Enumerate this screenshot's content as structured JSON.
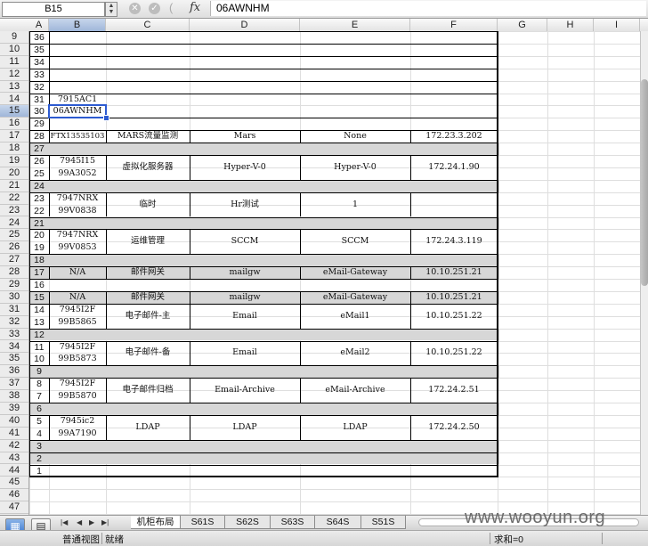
{
  "formula_bar": {
    "name_box": "B15",
    "cancel_glyph": "✕",
    "confirm_glyph": "✓",
    "paren_glyph": "(",
    "fx_label": "fx",
    "value": "06AWNHM"
  },
  "columns": [
    "A",
    "B",
    "C",
    "D",
    "E",
    "F",
    "G",
    "H",
    "I"
  ],
  "selected_column": "B",
  "rows": [
    "9",
    "10",
    "11",
    "12",
    "13",
    "14",
    "15",
    "16",
    "17",
    "18",
    "19",
    "20",
    "21",
    "22",
    "23",
    "24",
    "25",
    "26",
    "27",
    "28",
    "29",
    "30",
    "31",
    "32",
    "33",
    "34",
    "35",
    "36",
    "37",
    "38",
    "39",
    "40",
    "41",
    "42",
    "43",
    "44",
    "45",
    "46",
    "47"
  ],
  "selected_row": "15",
  "col_a_values": [
    "36",
    "35",
    "34",
    "33",
    "32",
    "31",
    "30",
    "29",
    "28",
    "27",
    "26",
    "25",
    "24",
    "23",
    "22",
    "21",
    "20",
    "19",
    "18",
    "17",
    "16",
    "15",
    "14",
    "13",
    "12",
    "11",
    "10",
    "9",
    "8",
    "7",
    "6",
    "5",
    "4",
    "3",
    "2",
    "1"
  ],
  "entries": [
    {
      "b": "7915AC1",
      "c": "",
      "d": "",
      "e": "",
      "f": ""
    },
    {
      "b": "06AWNHM",
      "c": "",
      "d": "",
      "e": "",
      "f": ""
    },
    {
      "b": "FTX13535103",
      "c": "MARS流量监测",
      "d": "Mars",
      "e": "None",
      "f": "172.23.3.202"
    },
    {
      "b1": "7945I15",
      "b2": "99A3052",
      "c": "虚拟化服务器",
      "d": "Hyper-V-0",
      "e": "Hyper-V-0",
      "f": "172.24.1.90"
    },
    {
      "b1": "7947NRX",
      "b2": "99V0838",
      "c": "临时",
      "d": "Hr测试",
      "e": "1",
      "f": ""
    },
    {
      "b1": "7947NRX",
      "b2": "99V0853",
      "c": "运维管理",
      "d": "SCCM",
      "e": "SCCM",
      "f": "172.24.3.119"
    },
    {
      "b": "N/A",
      "c": "邮件网关",
      "d": "mailgw",
      "e": "eMail-Gateway",
      "f": "10.10.251.21"
    },
    {
      "b": "N/A",
      "c": "邮件网关",
      "d": "mailgw",
      "e": "eMail-Gateway",
      "f": "10.10.251.21"
    },
    {
      "b1": "7945I2F",
      "b2": "99B5865",
      "c": "电子邮件-主",
      "d": "Email",
      "e": "eMail1",
      "f": "10.10.251.22"
    },
    {
      "b1": "7945I2F",
      "b2": "99B5873",
      "c": "电子邮件-备",
      "d": "Email",
      "e": "eMail2",
      "f": "10.10.251.22"
    },
    {
      "b1": "7945I2F",
      "b2": "99B5870",
      "c": "电子邮件归档",
      "d": "Email-Archive",
      "e": "eMail-Archive",
      "f": "172.24.2.51"
    },
    {
      "b1": "7945ic2",
      "b2": "99A7190",
      "c": "LDAP",
      "d": "LDAP",
      "e": "LDAP",
      "f": "172.24.2.50"
    }
  ],
  "sheet_nav": {
    "first": "|◀",
    "prev": "◀",
    "next": "▶",
    "last": "▶|"
  },
  "sheet_tabs": [
    "机柜布局",
    "S61S",
    "S62S",
    "S63S",
    "S64S",
    "S51S"
  ],
  "active_tab": "机柜布局",
  "view_buttons": {
    "normal_glyph": "▦",
    "layout_glyph": "▤"
  },
  "status_bar": {
    "view_label": "普通视图",
    "status": "就绪",
    "sum": "求和=0"
  },
  "watermark": "www.wooyun.org",
  "colors": {
    "selection": "#2d5bd1",
    "band": "#d7d7d7",
    "header_selected": "#9fb6d9"
  }
}
